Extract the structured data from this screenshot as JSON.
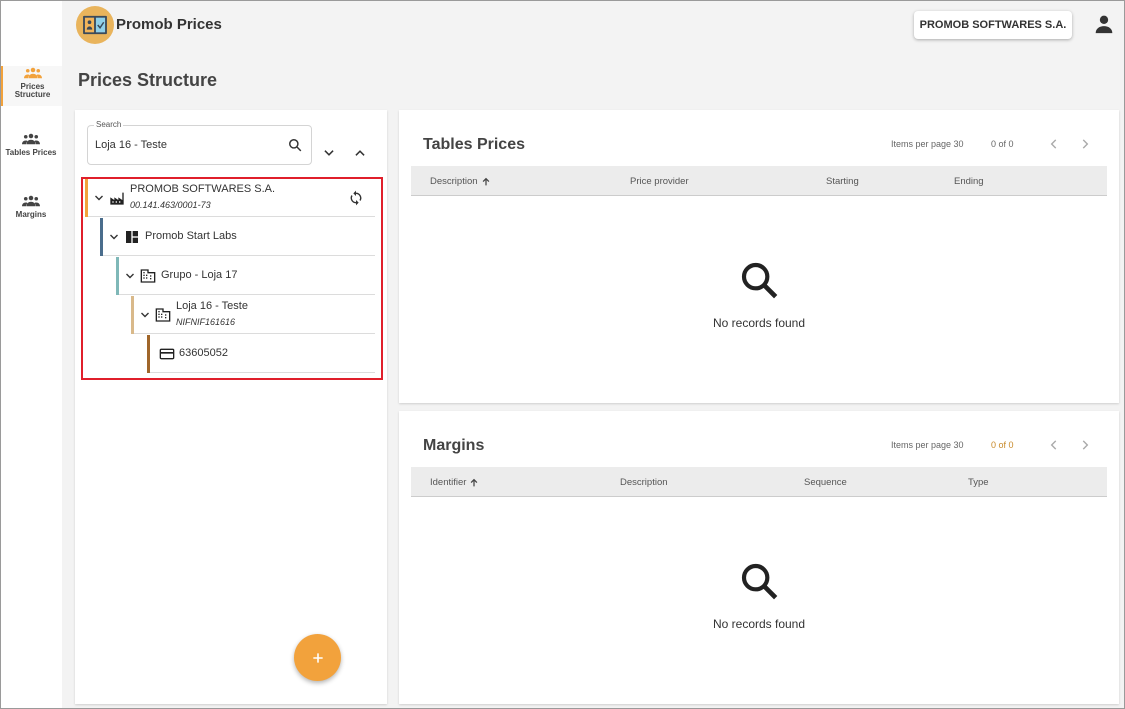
{
  "app": {
    "title": "Promob Prices",
    "company_button": "PROMOB SOFTWARES S.A."
  },
  "sidebar": {
    "items": [
      {
        "label": "Prices Structure",
        "icon": "people-icon",
        "active": true
      },
      {
        "label": "Tables Prices",
        "icon": "people-icon",
        "active": false
      },
      {
        "label": "Margins",
        "icon": "people-icon",
        "active": false
      }
    ]
  },
  "page": {
    "title": "Prices Structure"
  },
  "search": {
    "label": "Search",
    "value": "Loja 16 - Teste"
  },
  "tree": {
    "nodes": [
      {
        "name": "PROMOB SOFTWARES S.A.",
        "sub": "00.141.463/0001-73",
        "icon": "factory-icon",
        "bar_color": "#f2a23c"
      },
      {
        "name": "Promob Start Labs",
        "sub": "",
        "icon": "dashboard-icon",
        "bar_color": "#4a6d8c"
      },
      {
        "name": "Grupo - Loja 17",
        "sub": "",
        "icon": "building-icon",
        "bar_color": "#7fb8b8"
      },
      {
        "name": "Loja 16 - Teste",
        "sub": "NIFNIF161616",
        "icon": "building-icon",
        "bar_color": "#d9b98a"
      },
      {
        "name": "63605052",
        "sub": "",
        "icon": "card-icon",
        "bar_color": "#a0662a"
      }
    ]
  },
  "tables_prices": {
    "title": "Tables Prices",
    "items_per_page": "Items per page 30",
    "page_count": "0 of 0",
    "columns": [
      "Description",
      "Price provider",
      "Starting",
      "Ending"
    ],
    "empty_text": "No records found"
  },
  "margins": {
    "title": "Margins",
    "items_per_page": "Items per page 30",
    "page_count": "0 of 0",
    "columns": [
      "Identifier",
      "Description",
      "Sequence",
      "Type"
    ],
    "empty_text": "No records found"
  },
  "colors": {
    "accent": "#f2a23c",
    "highlight_border": "#e01f2b"
  }
}
